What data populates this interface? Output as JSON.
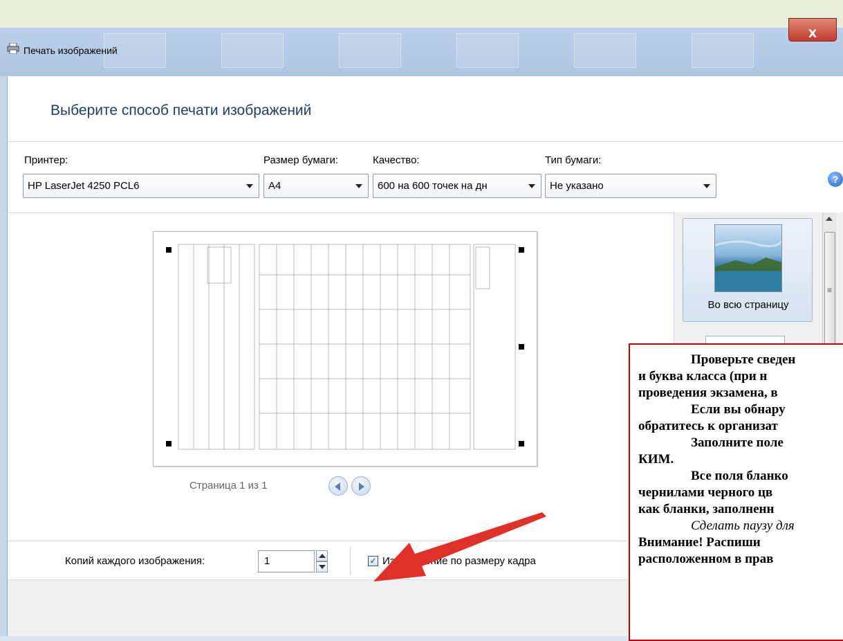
{
  "window": {
    "title": "Печать изображений",
    "close_label": "X"
  },
  "heading": "Выберите способ печати изображений",
  "printer": {
    "label": "Принтер:",
    "value": "HP LaserJet 4250 PCL6"
  },
  "paper_size": {
    "label": "Размер бумаги:",
    "value": "A4"
  },
  "quality": {
    "label": "Качество:",
    "value": "600 на 600 точек на дн"
  },
  "paper_type": {
    "label": "Тип бумаги:",
    "value": "Не указано"
  },
  "help_label": "?",
  "preview": {
    "pagination": "Страница 1 из 1"
  },
  "layouts": {
    "items": [
      {
        "label": "Во всю страницу"
      }
    ]
  },
  "copies": {
    "label": "Копий каждого изображения:",
    "value": "1"
  },
  "fit_to_frame": {
    "label": "Изображение по размеру кадра",
    "checked": true
  },
  "overlay_text": {
    "line1": "Проверьте сведен",
    "line2": "и буква  класса  (при  н",
    "line3": "проведения экзамена, в",
    "line4": "Если  вы  обнару",
    "line5": "обратитесь к организат",
    "line6": "Заполните  поле",
    "line7": "КИМ.",
    "line8": "Все поля бланко",
    "line9": "чернилами черного цв",
    "line10": "как бланки, заполненн",
    "line11": "Сделать паузу для",
    "line12": "Внимание!   Распиши",
    "line13": "расположенном в прав"
  },
  "colors": {
    "heading": "#1e3f66",
    "overlay_border": "#c00000",
    "arrow": "#e03128"
  }
}
